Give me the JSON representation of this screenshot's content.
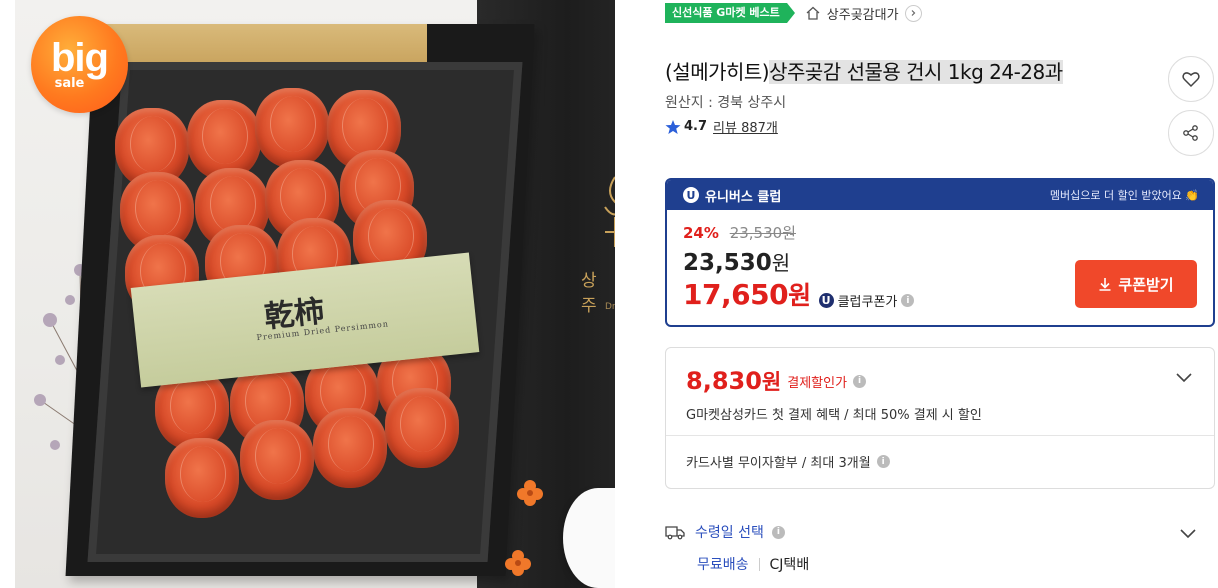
{
  "image": {
    "badge_big": "big",
    "badge_sale": "sale",
    "label_kanji": "乾柿",
    "label_sub": "Premium Dried Persimmon",
    "board_text": "상 주",
    "board_text2": "Dr"
  },
  "header": {
    "best_badge": "신선식품 G마켓 베스트",
    "shop_name": "상주곶감대가"
  },
  "product": {
    "title_brand": "(설메가히트)",
    "title_name": "상주곶감 선물용 건시 1kg 24-28과",
    "origin": "원산지 : 경북 상주시",
    "rating": "4.7",
    "reviews": "리뷰 887개"
  },
  "club": {
    "header_left": "유니버스 클럽",
    "header_right": "멤버십으로 더 할인 받았어요 👏",
    "u_mark": "U",
    "discount_pct": "24%",
    "original_price": "23,530원",
    "sale_price_num": "23,530",
    "sale_price_unit": "원",
    "club_price_num": "17,650",
    "club_price_unit": "원",
    "club_price_label": "클럽쿠폰가",
    "coupon_button": "쿠폰받기"
  },
  "payment": {
    "price_num": "8,830",
    "price_unit": "원",
    "price_label": "결제할인가",
    "description": "G마켓삼성카드 첫 결제 혜택 / 최대 50% 결제 시 할인",
    "installment": "카드사별 무이자할부 / 최대 3개월"
  },
  "delivery": {
    "title": "수령일 선택",
    "shipping": "무료배송",
    "carrier": "CJ택배"
  },
  "info_glyph": "i",
  "colors": {
    "accent_blue": "#1f3f8f",
    "price_red": "#e0201c",
    "coupon_orange": "#f0482a",
    "best_green": "#1fb35b"
  }
}
